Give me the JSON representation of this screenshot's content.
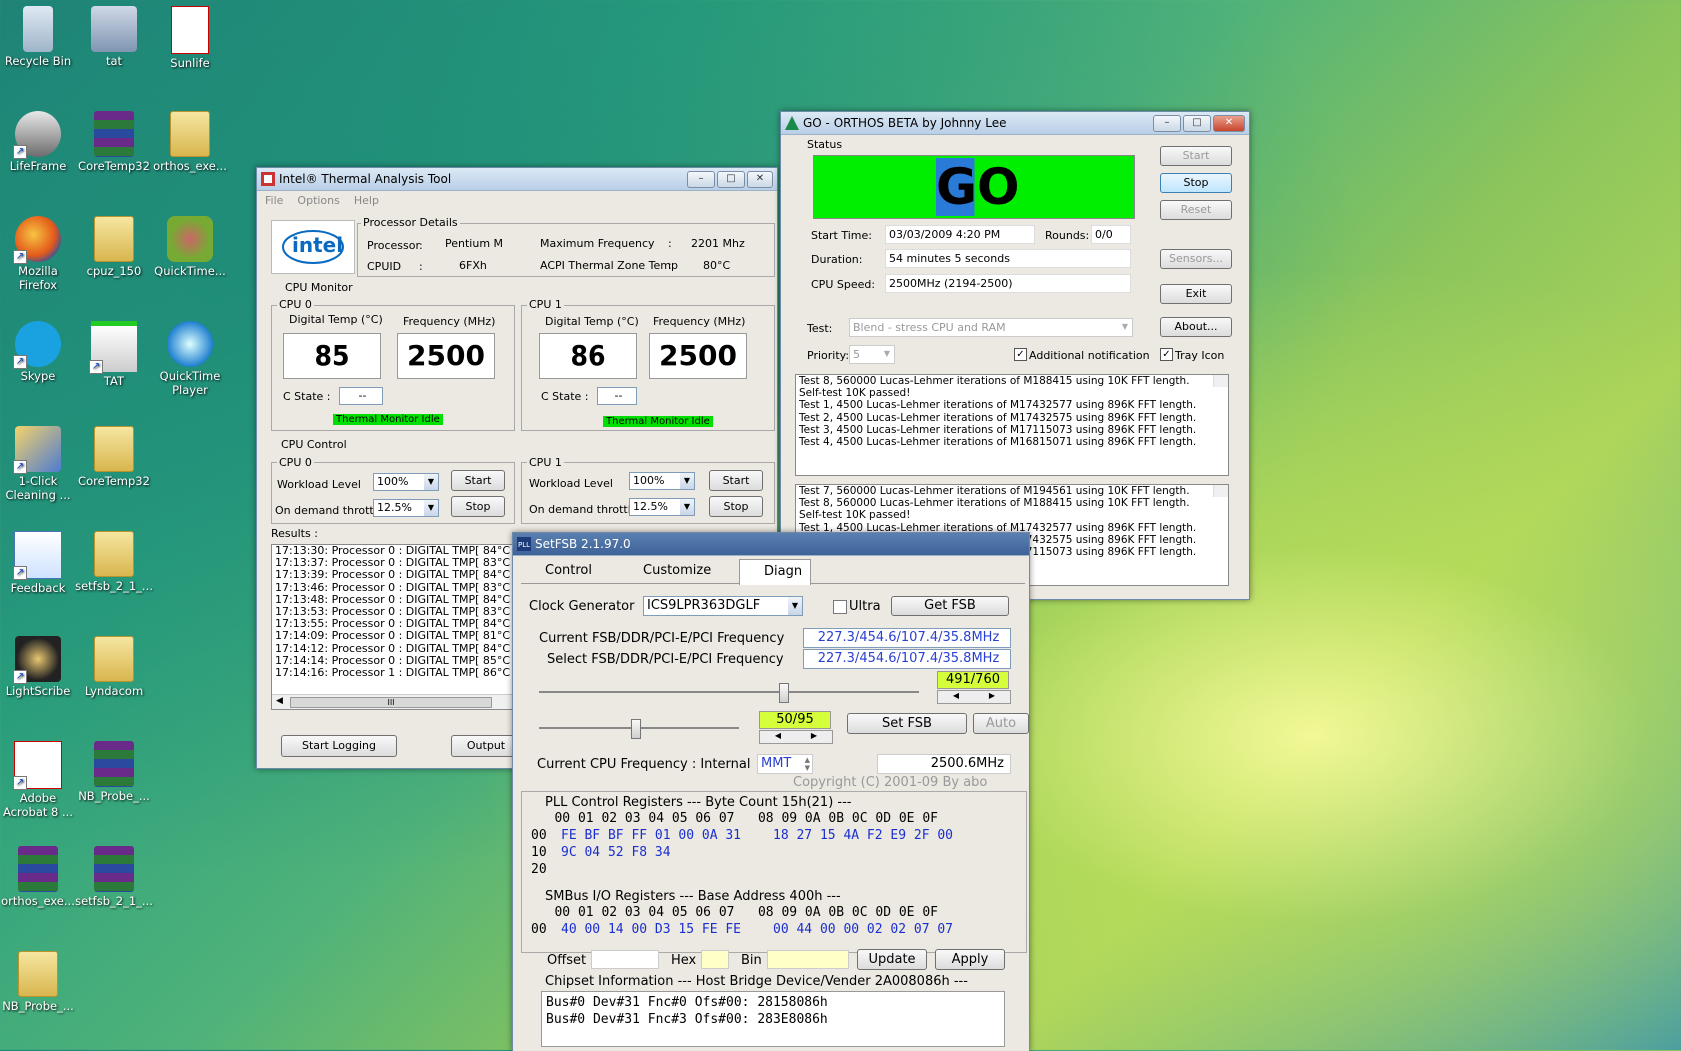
{
  "desktop": {
    "icons": [
      {
        "label": "Recycle Bin",
        "icon": "recycle-bin-icon"
      },
      {
        "label": "tat",
        "icon": "tat-disk-icon"
      },
      {
        "label": "Sunlife",
        "icon": "pdf-icon"
      },
      {
        "label": "LifeFrame",
        "icon": "lifeframe-icon"
      },
      {
        "label": "CoreTemp32",
        "icon": "winrar-icon"
      },
      {
        "label": "orthos_exe...",
        "icon": "folder-icon"
      },
      {
        "label": "Mozilla Firefox",
        "icon": "firefox-icon"
      },
      {
        "label": "cpuz_150",
        "icon": "folder-icon"
      },
      {
        "label": "QuickTime...",
        "icon": "quicktime-icon"
      },
      {
        "label": "Skype",
        "icon": "skype-icon"
      },
      {
        "label": "TAT",
        "icon": "tat-icon"
      },
      {
        "label": "QuickTime Player",
        "icon": "quicktime-player-icon"
      },
      {
        "label": "1-Click Cleaning ...",
        "icon": "cleaning-icon"
      },
      {
        "label": "CoreTemp32",
        "icon": "folder-icon"
      },
      {
        "label": "Feedback",
        "icon": "feedback-icon"
      },
      {
        "label": "setfsb_2_1_...",
        "icon": "folder-icon"
      },
      {
        "label": "LightScribe",
        "icon": "lightscribe-icon"
      },
      {
        "label": "Lyndacom",
        "icon": "folder-icon"
      },
      {
        "label": "Adobe Acrobat 8 ...",
        "icon": "acrobat-icon"
      },
      {
        "label": "NB_Probe_...",
        "icon": "winrar-icon"
      },
      {
        "label": "orthos_exe...",
        "icon": "winrar-icon"
      },
      {
        "label": "setfsb_2_1_...",
        "icon": "winrar-icon"
      },
      {
        "label": "NB_Probe_...",
        "icon": "folder-icon"
      }
    ]
  },
  "tat": {
    "title": "Intel® Thermal Analysis Tool",
    "menu": [
      "File",
      "Options",
      "Help"
    ],
    "logo": "intel",
    "processor_details": {
      "label": "Processor Details",
      "processor_label": "Processor",
      "processor_sep": ":",
      "processor_value": "Pentium M",
      "cpuid_label": "CPUID",
      "cpuid_sep": ":",
      "cpuid_value": "6FXh",
      "maxfreq_label": "Maximum Frequency",
      "maxfreq_sep": ":",
      "maxfreq_value": "2201 Mhz",
      "acpi_label": "ACPI Thermal Zone Temp",
      "acpi_sep": ":",
      "acpi_value": "80°C"
    },
    "cpu_monitor_label": "CPU Monitor",
    "cpu0": {
      "label": "CPU 0",
      "temp_header": "Digital Temp (°C)",
      "freq_header": "Frequency (MHz)",
      "temp": "85",
      "freq": "2500",
      "cstate_label": "C State :",
      "cstate": "--",
      "status": "Thermal Monitor Idle"
    },
    "cpu1": {
      "label": "CPU 1",
      "temp_header": "Digital Temp (°C)",
      "freq_header": "Frequency (MHz)",
      "temp": "86",
      "freq": "2500",
      "cstate_label": "C State :",
      "cstate": "--",
      "status": "Thermal Monitor Idle"
    },
    "cpu_control_label": "CPU Control",
    "ctrl0": {
      "label": "CPU 0",
      "workload_label": "Workload  Level",
      "workload": "100%",
      "throttle_label": "On demand throttle",
      "throttle": "12.5%",
      "start": "Start",
      "stop": "Stop"
    },
    "ctrl1": {
      "label": "CPU 1",
      "workload_label": "Workload  Level",
      "workload": "100%",
      "throttle_label": "On demand throttle",
      "throttle": "12.5%",
      "start": "Start",
      "stop": "Stop"
    },
    "results_label": "Results :",
    "results": [
      "17:13:30: Processor 0 : DIGITAL TMP[ 84°C ]",
      "17:13:37: Processor 0 : DIGITAL TMP[ 83°C ]",
      "17:13:39: Processor 0 : DIGITAL TMP[ 84°C ]",
      "17:13:46: Processor 0 : DIGITAL TMP[ 83°C ]",
      "17:13:48: Processor 0 : DIGITAL TMP[ 84°C ]",
      "17:13:53: Processor 0 : DIGITAL TMP[ 83°C ]",
      "17:13:55: Processor 0 : DIGITAL TMP[ 84°C ]",
      "17:14:09: Processor 0 : DIGITAL TMP[ 81°C ]",
      "17:14:12: Processor 0 : DIGITAL TMP[ 84°C ]",
      "17:14:14: Processor 0 : DIGITAL TMP[ 85°C ]",
      "17:14:16: Processor 1 : DIGITAL TMP[ 86°C ]"
    ],
    "hscroll_grip": "III",
    "start_logging": "Start Logging",
    "output": "Output"
  },
  "orthos": {
    "title": "GO - ORTHOS BETA by Johnny Lee",
    "status_label": "Status",
    "go_text": "GO",
    "start_time_label": "Start Time:",
    "start_time": "03/03/2009 4:20 PM",
    "rounds_label": "Rounds:",
    "rounds": "0/0",
    "duration_label": "Duration:",
    "duration": "54 minutes 5 seconds",
    "cpu_speed_label": "CPU Speed:",
    "cpu_speed": "2500MHz (2194-2500)",
    "buttons": {
      "start": "Start",
      "stop": "Stop",
      "reset": "Reset",
      "sensors": "Sensors...",
      "exit": "Exit",
      "about": "About..."
    },
    "test_label": "Test:",
    "test_value": "Blend - stress CPU and RAM",
    "priority_label": "Priority:",
    "priority_value": "5",
    "additional_notification": "Additional notification",
    "tray_icon": "Tray Icon",
    "log1": [
      "Test 8, 560000 Lucas-Lehmer iterations of M188415 using 10K FFT length.",
      "Self-test 10K passed!",
      "Test 1, 4500 Lucas-Lehmer iterations of M17432577 using 896K FFT length.",
      "Test 2, 4500 Lucas-Lehmer iterations of M17432575 using 896K FFT length.",
      "Test 3, 4500 Lucas-Lehmer iterations of M17115073 using 896K FFT length.",
      "Test 4, 4500 Lucas-Lehmer iterations of M16815071 using 896K FFT length."
    ],
    "log2": [
      "Test 7, 560000 Lucas-Lehmer iterations of M194561 using 10K FFT length.",
      "Test 8, 560000 Lucas-Lehmer iterations of M188415 using 10K FFT length.",
      "Self-test 10K passed!",
      "Test 1, 4500 Lucas-Lehmer iterations of M17432577 using 896K FFT length.",
      "Test 2, 4500 Lucas-Lehmer iterations of M17432575 using 896K FFT length.",
      "Test 3, 4500 Lucas-Lehmer iterations of M17115073 using 896K FFT length."
    ]
  },
  "setfsb": {
    "title": "SetFSB 2.1.97.0",
    "tabs": [
      "Control",
      "Customize",
      "Diagn"
    ],
    "clock_generator_label": "Clock Generator",
    "clock_generator": "ICS9LPR363DGLF",
    "ultra_label": "Ultra",
    "get_fsb": "Get FSB",
    "current_freq_label": "Current FSB/DDR/PCI-E/PCI Frequency",
    "current_freq": "227.3/454.6/107.4/35.8MHz",
    "select_freq_label": "Select FSB/DDR/PCI-E/PCI Frequency",
    "select_freq": "227.3/454.6/107.4/35.8MHz",
    "slider1_value": "491/760",
    "slider2_value": "50/95",
    "set_fsb": "Set FSB",
    "auto": "Auto",
    "cpu_freq_label": "Current CPU Frequency : Internal",
    "cpu_freq_source": "MMT",
    "cpu_freq_value": "2500.6MHz",
    "copyright": "Copyright (C) 2001-09 By abo",
    "pll_header": "PLL Control Registers  --- Byte Count 15h(21) ---",
    "pll_cols": "   00 01 02 03 04 05 06 07   08 09 0A 0B 0C 0D 0E 0F",
    "pll_row00_addr": "00",
    "pll_row00_a": "FE BF BF FF 01 00 0A 31",
    "pll_row00_b": "18 27 15 4A F2 E9 2F 00",
    "pll_row10_addr": "10",
    "pll_row10_a": "9C 04 52 F8 34",
    "pll_row20_addr": "20",
    "smbus_header": "SMBus I/O Registers  --- Base Address 400h ---",
    "smbus_cols": "   00 01 02 03 04 05 06 07   08 09 0A 0B 0C 0D 0E 0F",
    "smbus_row_addr": "00",
    "smbus_row_a": "40 00 14 00 D3 15 FE FE",
    "smbus_row_b": "00 44 00 00 02 02 07 07",
    "offset_label": "Offset",
    "hex_label": "Hex",
    "bin_label": "Bin",
    "update": "Update",
    "apply": "Apply",
    "chipset_header": "Chipset Information  --- Host Bridge Device/Vender 2A008086h ---",
    "chipset_lines": [
      "Bus#0 Dev#31 Fnc#0 Ofs#00: 28158086h",
      "Bus#0 Dev#31 Fnc#3 Ofs#00: 283E8086h"
    ]
  }
}
